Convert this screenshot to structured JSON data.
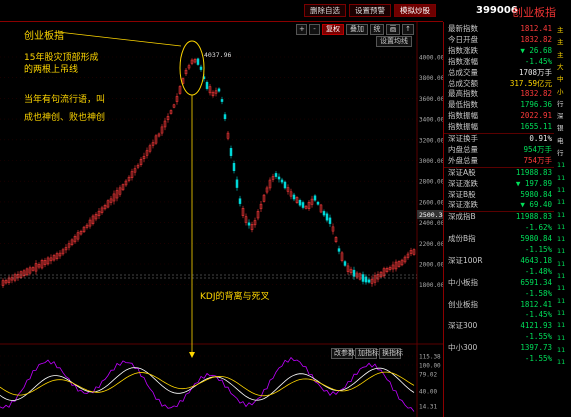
{
  "toolbar": {
    "btn_delete": "删除自选",
    "btn_warn": "设置预警",
    "btn_sim": "模拟炒股",
    "code": "399006",
    "name": "创业板指"
  },
  "chart_toolbar": {
    "labels": [
      "+",
      "-",
      "复权",
      "叠加",
      "统",
      "画",
      "↑"
    ],
    "cross": "设置均线"
  },
  "y_axis": {
    "ticks": [
      "4000.00",
      "3800.00",
      "3600.00",
      "3400.00",
      "3200.00",
      "3000.00",
      "2800.00",
      "2600.00",
      "2400.00",
      "2200.00",
      "2000.00",
      "1800.00"
    ],
    "current": "2500.34"
  },
  "kdj": {
    "title_buttons": [
      "改参数",
      "加指标",
      "换指标"
    ],
    "ticks": [
      "115.38",
      "100.00",
      "79.02",
      "40.00",
      "14.31"
    ]
  },
  "annotations": {
    "title": "创业板指",
    "line1": "15年股灾顶部形成",
    "line2": "的两根上吊线",
    "line3": "当年有句流行语，叫",
    "line4": "成也神创、败也神创",
    "kdj_note": "KDJ的背离与死叉",
    "peak_label": "4037.96"
  },
  "panel": {
    "rows": [
      {
        "label": "最新指数",
        "value": "1812.41",
        "color": "red"
      },
      {
        "label": "今日开盘",
        "value": "1832.82",
        "color": "red"
      },
      {
        "label": "指数涨跌",
        "value": "▼ 26.68",
        "color": "green"
      },
      {
        "label": "指数涨幅",
        "value": "-1.45%",
        "color": "green"
      },
      {
        "label": "总成交量",
        "value": "1708万手",
        "color": "white"
      },
      {
        "label": "总成交额",
        "value": "317.59亿元",
        "color": "yellow"
      },
      {
        "label": "最高指数",
        "value": "1832.82",
        "color": "red"
      },
      {
        "label": "最低指数",
        "value": "1796.36",
        "color": "green"
      },
      {
        "label": "指数振幅",
        "value": "2022.91",
        "color": "red"
      },
      {
        "label": "指数振幅",
        "value": "1655.11",
        "color": "green"
      },
      {
        "label": "深证换手",
        "value": "0.91%",
        "color": "white"
      },
      {
        "label": "内盘总量",
        "value": "954万手",
        "color": "green"
      },
      {
        "label": "外盘总量",
        "value": "754万手",
        "color": "red"
      },
      {
        "label": "深证A股",
        "value": "11988.83",
        "color": "green"
      },
      {
        "label": "深证涨跌",
        "value": "▼ 197.89",
        "color": "green"
      },
      {
        "label": "深证B股",
        "value": "5980.84",
        "color": "green"
      },
      {
        "label": "深证涨跌",
        "value": "▼ 69.40",
        "color": "green"
      },
      {
        "label": "深成指B",
        "value": "11988.83",
        "color": "green"
      },
      {
        "label": "",
        "value": "-1.62%",
        "color": "green"
      },
      {
        "label": "成份B指",
        "value": "5980.84",
        "color": "green"
      },
      {
        "label": "",
        "value": "-1.15%",
        "color": "green"
      },
      {
        "label": "深证100R",
        "value": "4643.18",
        "color": "green"
      },
      {
        "label": "",
        "value": "-1.48%",
        "color": "green"
      },
      {
        "label": "中小板指",
        "value": "6591.34",
        "color": "green"
      },
      {
        "label": "",
        "value": "-1.58%",
        "color": "green"
      },
      {
        "label": "创业板指",
        "value": "1812.41",
        "color": "green"
      },
      {
        "label": "",
        "value": "-1.45%",
        "color": "green"
      },
      {
        "label": "深证300",
        "value": "4121.93",
        "color": "green"
      },
      {
        "label": "",
        "value": "-1.55%",
        "color": "green"
      },
      {
        "label": "中小300",
        "value": "1397.73",
        "color": "green"
      },
      {
        "label": "",
        "value": "-1.55%",
        "color": "green"
      }
    ]
  },
  "side_strip": {
    "items": [
      "主",
      "主",
      "主",
      "大",
      "中",
      "小",
      "行",
      "深",
      "银",
      "电",
      "行",
      "11",
      "11",
      "11",
      "11",
      "11",
      "11",
      "11",
      "11",
      "11",
      "11",
      "11",
      "11",
      "11",
      "11",
      "11",
      "11",
      "11"
    ]
  },
  "colors": {
    "up": "#ff3b3b",
    "down": "#00d8d8",
    "k_line": "#ffffff",
    "d_line": "#ffd700",
    "j_line": "#c000ff"
  }
}
